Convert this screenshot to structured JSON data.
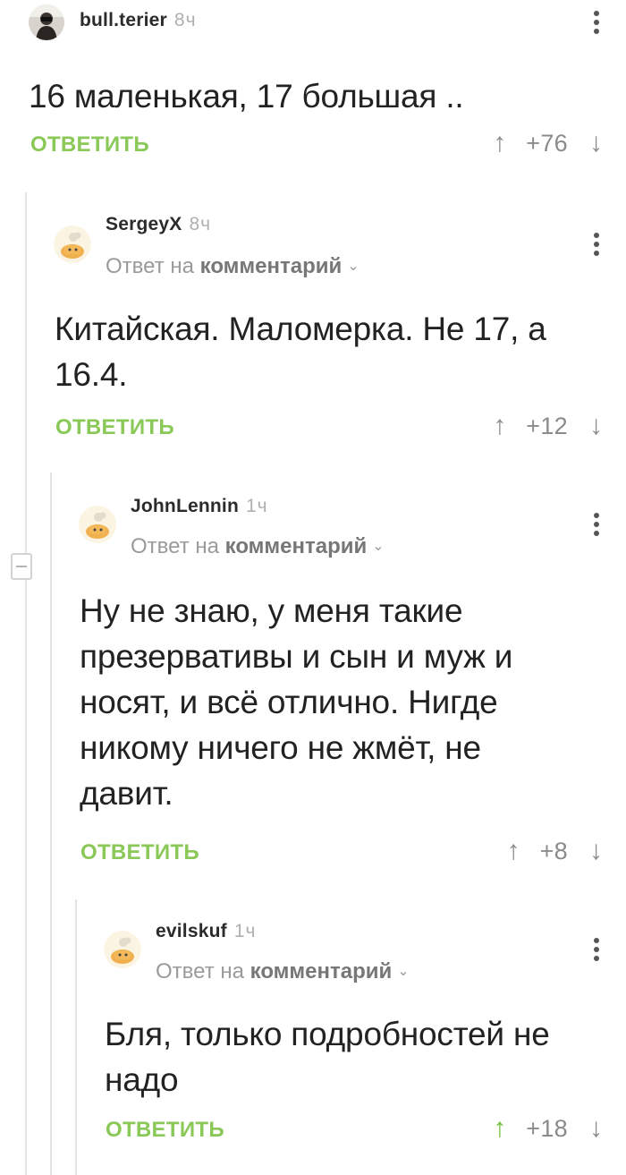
{
  "comments": [
    {
      "nick": "bull.terier",
      "time": "8ч",
      "text": "16 маленькая, 17 большая ..",
      "reply_label": "ОТВЕТИТЬ",
      "rating": "+76",
      "avatar": "photo-avatar"
    },
    {
      "nick": "SergeyX",
      "time": "8ч",
      "reply_to_prefix": "Ответ на",
      "reply_to_link": "комментарий",
      "text": "Китайская. Маломерка. Не 17, а 16.4.",
      "reply_label": "ОТВЕТИТЬ",
      "rating": "+12",
      "avatar": "default-pikabu-avatar"
    },
    {
      "nick": "JohnLennin",
      "time": "1ч",
      "reply_to_prefix": "Ответ на",
      "reply_to_link": "комментарий",
      "text": "Ну не знаю, у меня такие презервативы и сын и муж и носят, и всё отлично. Нигде никому ничего не жмёт, не давит.",
      "reply_label": "ОТВЕТИТЬ",
      "rating": "+8",
      "avatar": "default-pikabu-avatar"
    },
    {
      "nick": "evilskuf",
      "time": "1ч",
      "reply_to_prefix": "Ответ на",
      "reply_to_link": "комментарий",
      "text": "Бля, только подробностей не надо",
      "reply_label": "ОТВЕТИТЬ",
      "rating": "+18",
      "upvoted": true,
      "avatar": "default-pikabu-avatar"
    }
  ],
  "icons": {
    "upvote": "arrow-up-icon",
    "downvote": "arrow-down-icon",
    "more": "more-vertical-icon",
    "chevron": "chevron-down-icon",
    "collapse": "collapse-minus-icon"
  },
  "glyphs": {
    "up": "↑",
    "down": "↓",
    "chevron": "⌄"
  },
  "colors": {
    "reply": "#8ac858",
    "upvote_active": "#6fbf3a",
    "thread_line": "#e4e4e4"
  }
}
